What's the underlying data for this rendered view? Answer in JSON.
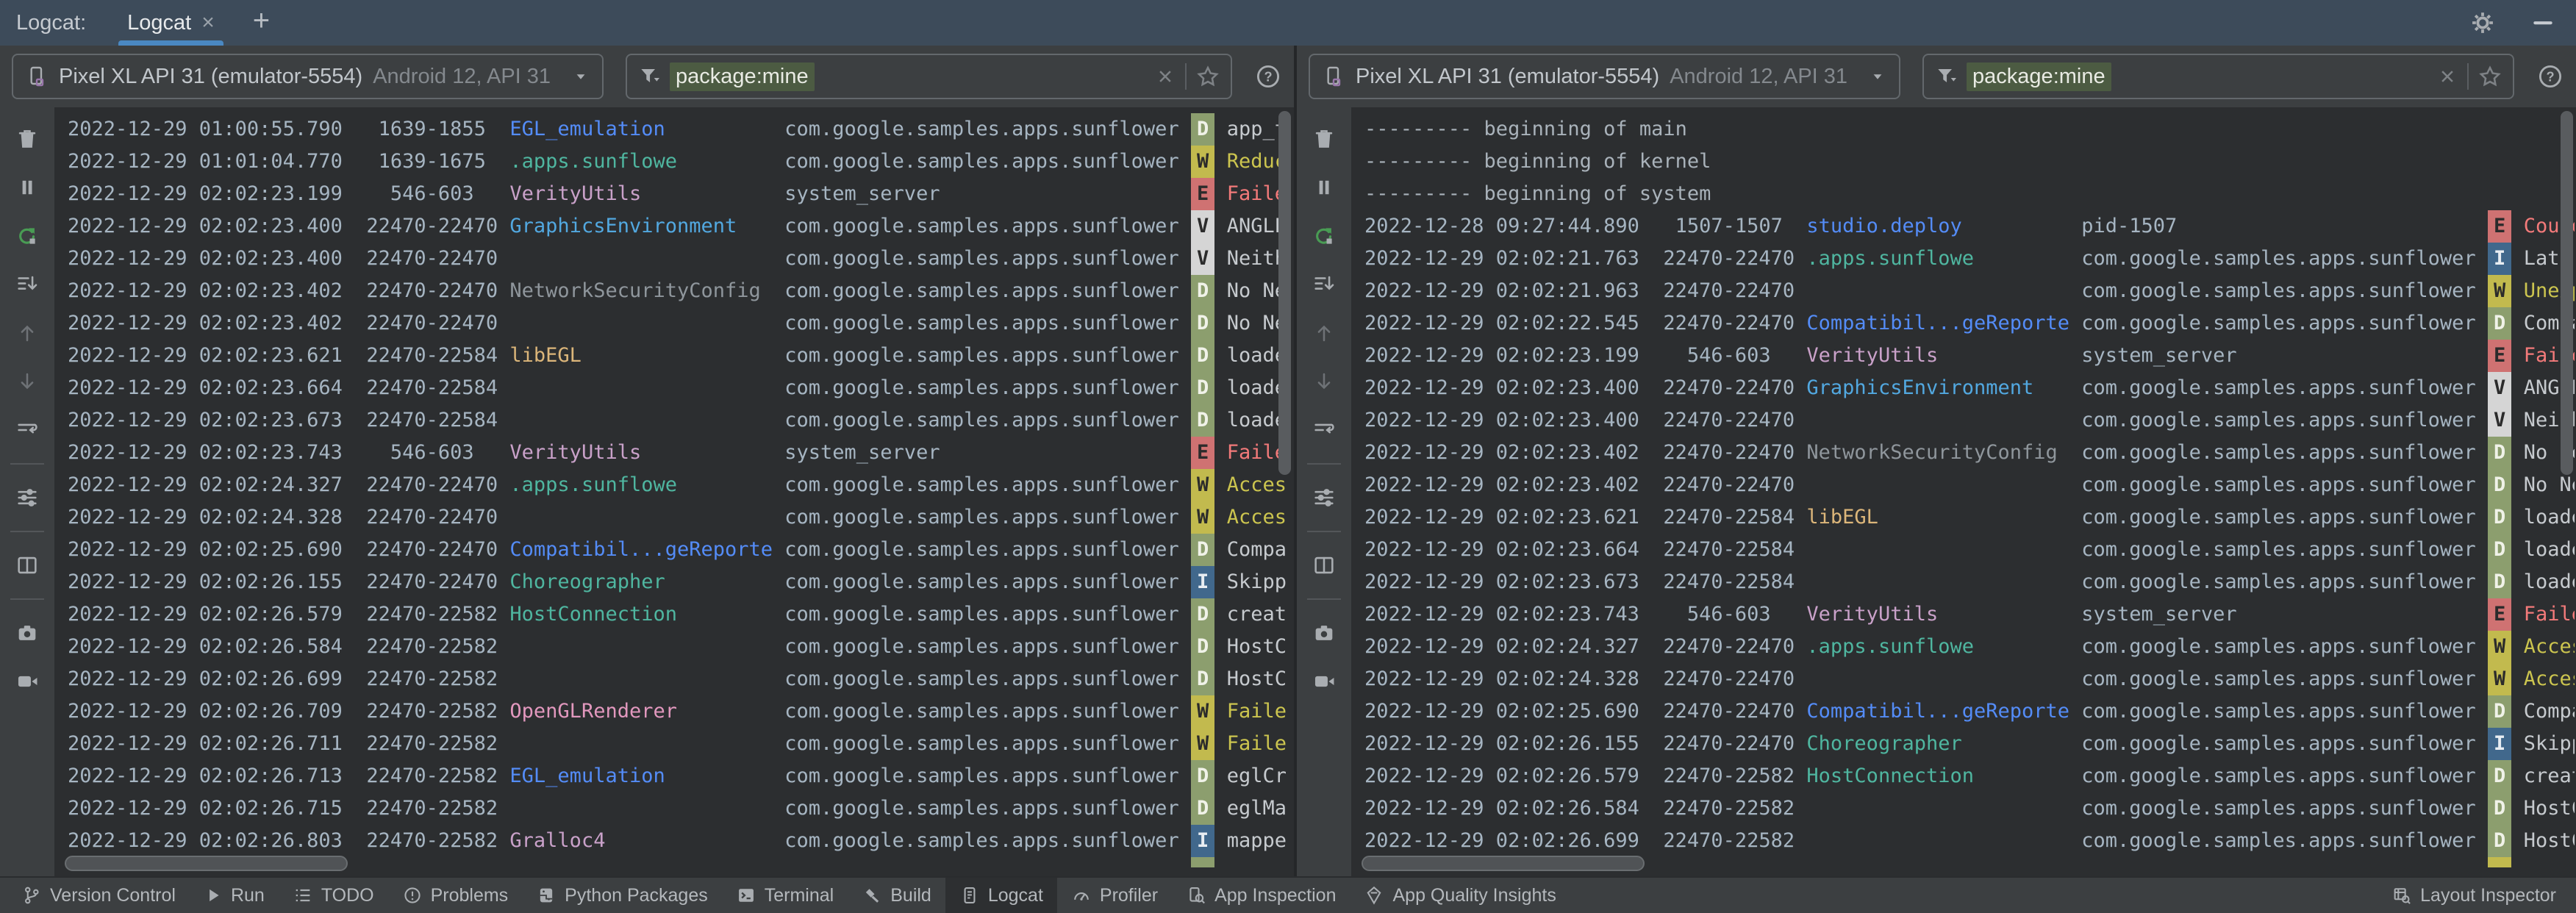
{
  "header": {
    "group_label": "Logcat:",
    "tab_label": "Logcat",
    "tab_close": "×",
    "new_tab": "+"
  },
  "log_toolbar": {
    "icons": [
      "clear-logcat",
      "pause-logcat",
      "restart-logcat",
      "scroll-to-end",
      "previous-occurrence",
      "next-occurrence",
      "soft-wrap",
      "separator",
      "configure-logcat",
      "separator",
      "split-panels",
      "separator",
      "take-screenshot",
      "record-screen"
    ]
  },
  "panels": [
    {
      "device": {
        "name": "Pixel XL API 31 (emulator-5554)",
        "details": "Android 12, API 31"
      },
      "filter": {
        "value": "package:mine"
      },
      "partial_next_badge": "D",
      "rows": [
        [
          "2022-12-29 01:00:55.790",
          "1639-1855",
          "EGL_emulation",
          "blue",
          "com.google.samples.apps.sunflower",
          "D",
          "app_t"
        ],
        [
          "2022-12-29 01:01:04.770",
          "1639-1675",
          ".apps.sunflowe",
          "teal",
          "com.google.samples.apps.sunflower",
          "W",
          "Reduc"
        ],
        [
          "2022-12-29 02:02:23.199",
          "546-603",
          "VerityUtils",
          "pink",
          "system_server",
          "E",
          "Faile"
        ],
        [
          "2022-12-29 02:02:23.400",
          "22470-22470",
          "GraphicsEnvironment",
          "azure",
          "com.google.samples.apps.sunflower",
          "V",
          "ANGLE"
        ],
        [
          "2022-12-29 02:02:23.400",
          "22470-22470",
          "",
          "",
          "com.google.samples.apps.sunflower",
          "V",
          "Neith"
        ],
        [
          "2022-12-29 02:02:23.402",
          "22470-22470",
          "NetworkSecurityConfig",
          "gray",
          "com.google.samples.apps.sunflower",
          "D",
          "No Ne"
        ],
        [
          "2022-12-29 02:02:23.402",
          "22470-22470",
          "",
          "",
          "com.google.samples.apps.sunflower",
          "D",
          "No Ne"
        ],
        [
          "2022-12-29 02:02:23.621",
          "22470-22584",
          "libEGL",
          "tan",
          "com.google.samples.apps.sunflower",
          "D",
          "loade"
        ],
        [
          "2022-12-29 02:02:23.664",
          "22470-22584",
          "",
          "",
          "com.google.samples.apps.sunflower",
          "D",
          "loade"
        ],
        [
          "2022-12-29 02:02:23.673",
          "22470-22584",
          "",
          "",
          "com.google.samples.apps.sunflower",
          "D",
          "loade"
        ],
        [
          "2022-12-29 02:02:23.743",
          "546-603",
          "VerityUtils",
          "pink",
          "system_server",
          "E",
          "Faile"
        ],
        [
          "2022-12-29 02:02:24.327",
          "22470-22470",
          ".apps.sunflowe",
          "teal",
          "com.google.samples.apps.sunflower",
          "W",
          "Acces"
        ],
        [
          "2022-12-29 02:02:24.328",
          "22470-22470",
          "",
          "",
          "com.google.samples.apps.sunflower",
          "W",
          "Acces"
        ],
        [
          "2022-12-29 02:02:25.690",
          "22470-22470",
          "Compatibil...geReporter",
          "blue",
          "com.google.samples.apps.sunflower",
          "D",
          "Compa"
        ],
        [
          "2022-12-29 02:02:26.155",
          "22470-22470",
          "Choreographer",
          "teal",
          "com.google.samples.apps.sunflower",
          "I",
          "Skipp"
        ],
        [
          "2022-12-29 02:02:26.579",
          "22470-22582",
          "HostConnection",
          "teal",
          "com.google.samples.apps.sunflower",
          "D",
          "creat"
        ],
        [
          "2022-12-29 02:02:26.584",
          "22470-22582",
          "",
          "",
          "com.google.samples.apps.sunflower",
          "D",
          "HostC"
        ],
        [
          "2022-12-29 02:02:26.699",
          "22470-22582",
          "",
          "",
          "com.google.samples.apps.sunflower",
          "D",
          "HostC"
        ],
        [
          "2022-12-29 02:02:26.709",
          "22470-22582",
          "OpenGLRenderer",
          "rose",
          "com.google.samples.apps.sunflower",
          "W",
          "Faile"
        ],
        [
          "2022-12-29 02:02:26.711",
          "22470-22582",
          "",
          "",
          "com.google.samples.apps.sunflower",
          "W",
          "Faile"
        ],
        [
          "2022-12-29 02:02:26.713",
          "22470-22582",
          "EGL_emulation",
          "blue",
          "com.google.samples.apps.sunflower",
          "D",
          "eglCr"
        ],
        [
          "2022-12-29 02:02:26.715",
          "22470-22582",
          "",
          "",
          "com.google.samples.apps.sunflower",
          "D",
          "eglMa"
        ],
        [
          "2022-12-29 02:02:26.803",
          "22470-22582",
          "Gralloc4",
          "pink",
          "com.google.samples.apps.sunflower",
          "I",
          "mappe"
        ]
      ]
    },
    {
      "device": {
        "name": "Pixel XL API 31 (emulator-5554)",
        "details": "Android 12, API 31"
      },
      "filter": {
        "value": "package:mine"
      },
      "partial_next_badge": "W",
      "rows": [
        {
          "sep": "--------- beginning of main"
        },
        {
          "sep": "--------- beginning of kernel"
        },
        {
          "sep": "--------- beginning of system"
        },
        [
          "2022-12-28 09:27:44.890",
          "1507-1507",
          "studio.deploy",
          "blue",
          "pid-1507",
          "E",
          "Could"
        ],
        [
          "2022-12-29 02:02:21.763",
          "22470-22470",
          ".apps.sunflowe",
          "teal",
          "com.google.samples.apps.sunflower",
          "I",
          "Late-"
        ],
        [
          "2022-12-29 02:02:21.963",
          "22470-22470",
          "",
          "",
          "com.google.samples.apps.sunflower",
          "W",
          "Unexp"
        ],
        [
          "2022-12-29 02:02:22.545",
          "22470-22470",
          "Compatibil...geReporter",
          "blue",
          "com.google.samples.apps.sunflower",
          "D",
          "Compa"
        ],
        [
          "2022-12-29 02:02:23.199",
          "546-603",
          "VerityUtils",
          "pink",
          "system_server",
          "E",
          "Faile"
        ],
        [
          "2022-12-29 02:02:23.400",
          "22470-22470",
          "GraphicsEnvironment",
          "azure",
          "com.google.samples.apps.sunflower",
          "V",
          "ANGLE"
        ],
        [
          "2022-12-29 02:02:23.400",
          "22470-22470",
          "",
          "",
          "com.google.samples.apps.sunflower",
          "V",
          "Neith"
        ],
        [
          "2022-12-29 02:02:23.402",
          "22470-22470",
          "NetworkSecurityConfig",
          "gray",
          "com.google.samples.apps.sunflower",
          "D",
          "No Ne"
        ],
        [
          "2022-12-29 02:02:23.402",
          "22470-22470",
          "",
          "",
          "com.google.samples.apps.sunflower",
          "D",
          "No Ne"
        ],
        [
          "2022-12-29 02:02:23.621",
          "22470-22584",
          "libEGL",
          "tan",
          "com.google.samples.apps.sunflower",
          "D",
          "loade"
        ],
        [
          "2022-12-29 02:02:23.664",
          "22470-22584",
          "",
          "",
          "com.google.samples.apps.sunflower",
          "D",
          "loade"
        ],
        [
          "2022-12-29 02:02:23.673",
          "22470-22584",
          "",
          "",
          "com.google.samples.apps.sunflower",
          "D",
          "loade"
        ],
        [
          "2022-12-29 02:02:23.743",
          "546-603",
          "VerityUtils",
          "pink",
          "system_server",
          "E",
          "Faile"
        ],
        [
          "2022-12-29 02:02:24.327",
          "22470-22470",
          ".apps.sunflowe",
          "teal",
          "com.google.samples.apps.sunflower",
          "W",
          "Acces"
        ],
        [
          "2022-12-29 02:02:24.328",
          "22470-22470",
          "",
          "",
          "com.google.samples.apps.sunflower",
          "W",
          "Acces"
        ],
        [
          "2022-12-29 02:02:25.690",
          "22470-22470",
          "Compatibil...geReporter",
          "blue",
          "com.google.samples.apps.sunflower",
          "D",
          "Compa"
        ],
        [
          "2022-12-29 02:02:26.155",
          "22470-22470",
          "Choreographer",
          "teal",
          "com.google.samples.apps.sunflower",
          "I",
          "Skipp"
        ],
        [
          "2022-12-29 02:02:26.579",
          "22470-22582",
          "HostConnection",
          "teal",
          "com.google.samples.apps.sunflower",
          "D",
          "creat"
        ],
        [
          "2022-12-29 02:02:26.584",
          "22470-22582",
          "",
          "",
          "com.google.samples.apps.sunflower",
          "D",
          "HostC"
        ],
        [
          "2022-12-29 02:02:26.699",
          "22470-22582",
          "",
          "",
          "com.google.samples.apps.sunflower",
          "D",
          "HostC"
        ]
      ]
    }
  ],
  "status_bar": {
    "left": [
      {
        "label": "Version Control",
        "icon": "branch",
        "active": false
      },
      {
        "label": "Run",
        "icon": "play",
        "active": false
      },
      {
        "label": "TODO",
        "icon": "todo",
        "active": false
      },
      {
        "label": "Problems",
        "icon": "problems",
        "active": false
      },
      {
        "label": "Python Packages",
        "icon": "python",
        "active": false
      },
      {
        "label": "Terminal",
        "icon": "terminal",
        "active": false
      },
      {
        "label": "Build",
        "icon": "build",
        "active": false
      },
      {
        "label": "Logcat",
        "icon": "logcat",
        "active": true
      },
      {
        "label": "Profiler",
        "icon": "profiler",
        "active": false
      },
      {
        "label": "App Inspection",
        "icon": "app-inspection",
        "active": false
      },
      {
        "label": "App Quality Insights",
        "icon": "quality-insights",
        "active": false
      }
    ],
    "right": [
      {
        "label": "Layout Inspector",
        "icon": "layout-inspector",
        "active": false
      }
    ]
  },
  "colors": {
    "accent_underline": "#4A88C2",
    "filter_highlight": "#4C5B42",
    "tags": {
      "blue": "#548CF7",
      "teal": "#4FB6A0",
      "pink": "#C9A1C9",
      "azure": "#52A8E0",
      "gray": "#8F969C",
      "tan": "#DCB67A",
      "rose": "#E298BE"
    },
    "levels": {
      "D": {
        "bg": "#8C9E6E",
        "fg": "#F0F2E8",
        "msg": "#C6CACE"
      },
      "W": {
        "bg": "#C2BA4E",
        "fg": "#2B2B2B",
        "msg": "#CCC54F"
      },
      "E": {
        "bg": "#CF7272",
        "fg": "#2B2B2B",
        "msg": "#F37A7A"
      },
      "V": {
        "bg": "#D5D5D5",
        "fg": "#2B2B2B",
        "msg": "#C6CACE"
      },
      "I": {
        "bg": "#41688C",
        "fg": "#E8EDF2",
        "msg": "#C6CACE"
      }
    }
  }
}
